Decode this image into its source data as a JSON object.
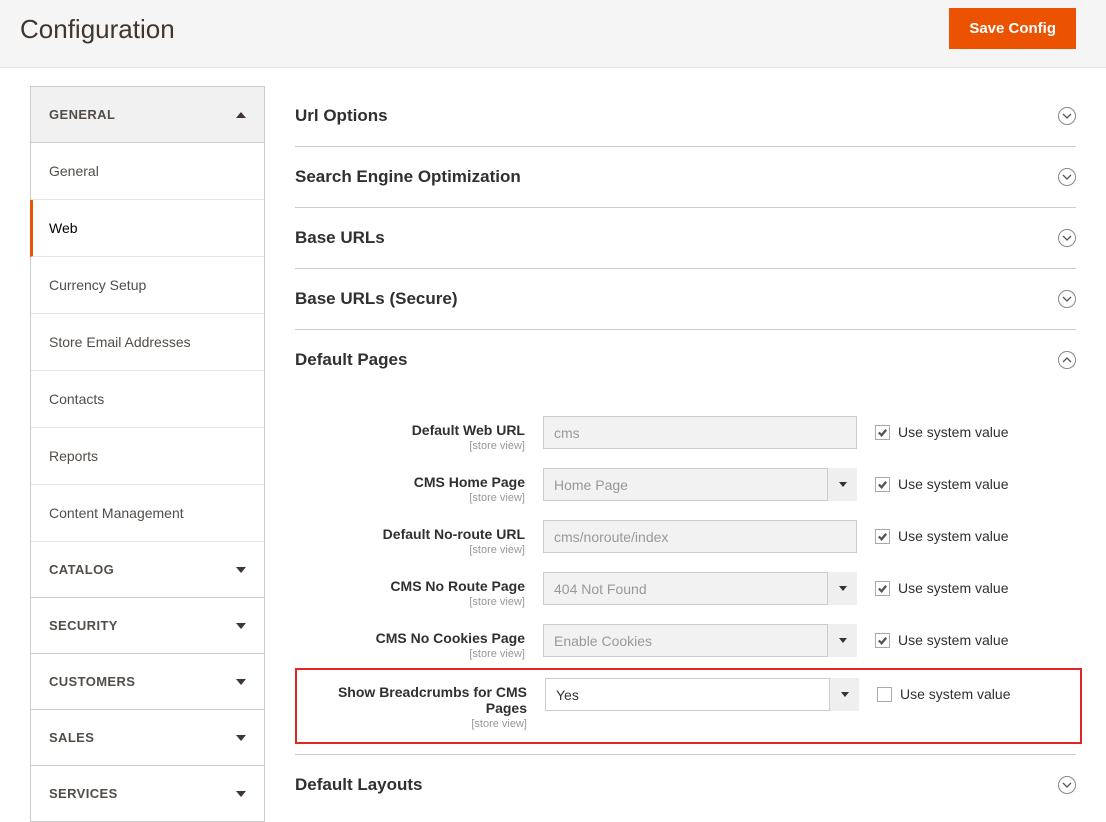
{
  "header": {
    "title": "Configuration",
    "save_button": "Save Config"
  },
  "sidebar": {
    "groups": [
      {
        "label": "GENERAL",
        "expanded": true,
        "items": [
          {
            "label": "General",
            "active": false
          },
          {
            "label": "Web",
            "active": true
          },
          {
            "label": "Currency Setup",
            "active": false
          },
          {
            "label": "Store Email Addresses",
            "active": false
          },
          {
            "label": "Contacts",
            "active": false
          },
          {
            "label": "Reports",
            "active": false
          },
          {
            "label": "Content Management",
            "active": false
          }
        ]
      },
      {
        "label": "CATALOG",
        "expanded": false
      },
      {
        "label": "SECURITY",
        "expanded": false
      },
      {
        "label": "CUSTOMERS",
        "expanded": false
      },
      {
        "label": "SALES",
        "expanded": false
      },
      {
        "label": "SERVICES",
        "expanded": false
      }
    ]
  },
  "sections": {
    "url_options": "Url Options",
    "seo": "Search Engine Optimization",
    "base_urls": "Base URLs",
    "base_urls_secure": "Base URLs (Secure)",
    "default_pages": "Default Pages",
    "default_layouts": "Default Layouts"
  },
  "fields": {
    "scope_label": "[store view]",
    "use_system_label": "Use system value",
    "default_web_url": {
      "label": "Default Web URL",
      "value": "cms",
      "use_system": true
    },
    "cms_home_page": {
      "label": "CMS Home Page",
      "value": "Home Page",
      "use_system": true
    },
    "default_noroute_url": {
      "label": "Default No-route URL",
      "value": "cms/noroute/index",
      "use_system": true
    },
    "cms_noroute_page": {
      "label": "CMS No Route Page",
      "value": "404 Not Found",
      "use_system": true
    },
    "cms_nocookies_page": {
      "label": "CMS No Cookies Page",
      "value": "Enable Cookies",
      "use_system": true
    },
    "show_breadcrumbs": {
      "label": "Show Breadcrumbs for CMS Pages",
      "value": "Yes",
      "use_system": false
    }
  }
}
